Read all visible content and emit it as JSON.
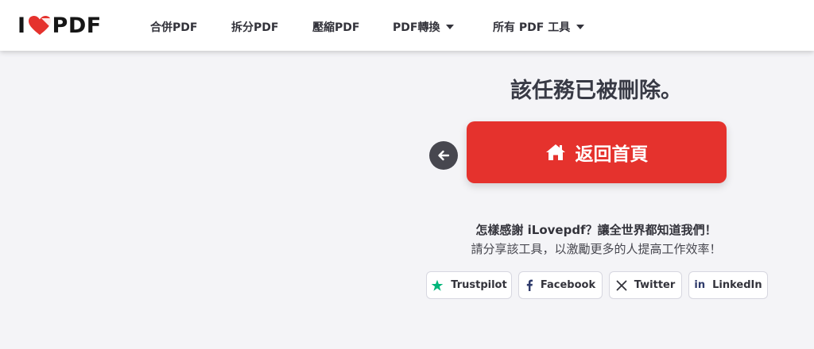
{
  "header": {
    "logo": {
      "prefix": "I",
      "suffix": "PDF"
    },
    "nav": [
      {
        "label": "合併PDF"
      },
      {
        "label": "拆分PDF"
      },
      {
        "label": "壓縮PDF"
      },
      {
        "label": "PDF轉換"
      },
      {
        "label": "所有 PDF 工具"
      }
    ]
  },
  "main": {
    "heading": "該任務已被刪除。",
    "home_button": "返回首頁",
    "thanks_text": "怎樣感謝 iLovepdf？讓全世界都知道我們！",
    "share_text": "請分享該工具，以激勵更多的人提高工作效率！",
    "social": [
      {
        "label": "Trustpilot",
        "icon": "star-icon"
      },
      {
        "label": "Facebook",
        "icon": "facebook-icon"
      },
      {
        "label": "Twitter",
        "icon": "x-twitter-icon"
      },
      {
        "label": "LinkedIn",
        "icon": "linkedin-icon"
      }
    ]
  },
  "colors": {
    "brand_red": "#e5322d",
    "trustpilot_green": "#00b67a",
    "background": "#f4f4f7",
    "back_button": "#47474f"
  }
}
